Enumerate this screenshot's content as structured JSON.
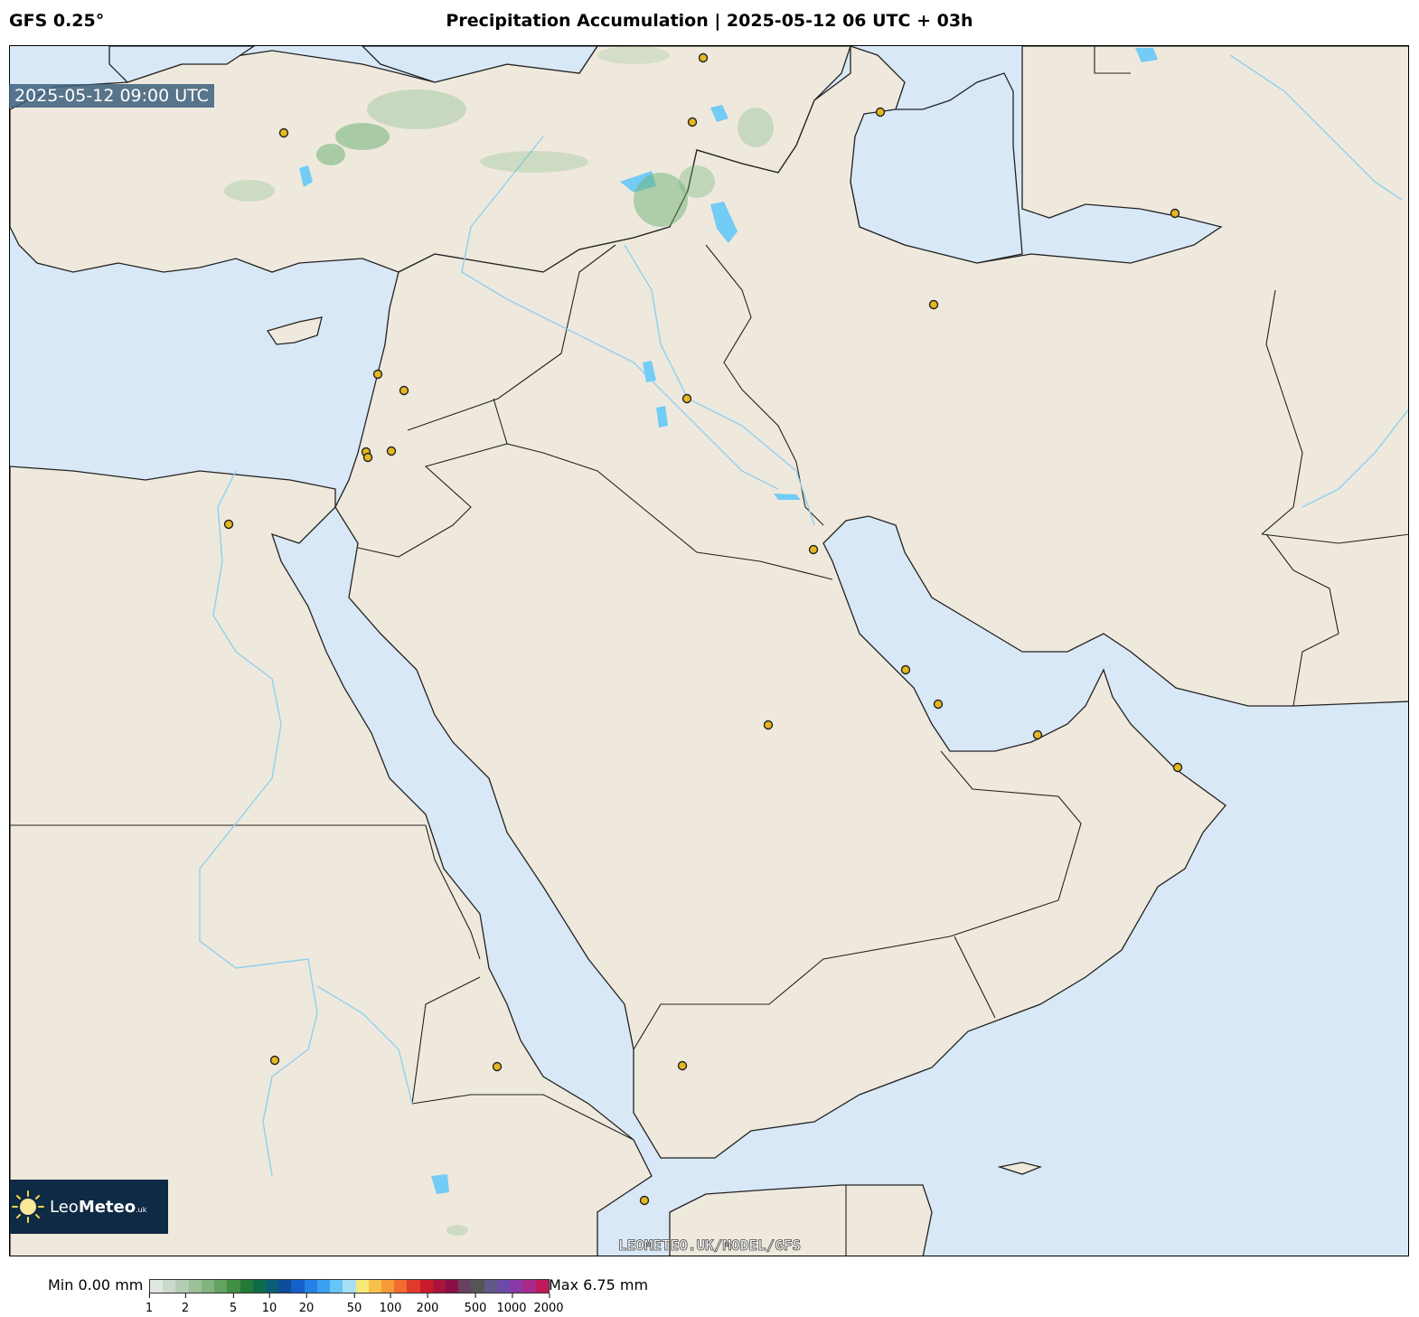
{
  "header": {
    "model": "GFS 0.25°",
    "title": "Precipitation Accumulation | 2025-05-12 06 UTC + 03h"
  },
  "map": {
    "valid_time": "2025-05-12 09:00 UTC",
    "watermark": "LEOMETEO.UK/MODEL/GFS",
    "colors": {
      "sea": "#d9e8f6",
      "land": "#efe9dd",
      "rivers": "#8fd0ef",
      "lakes": "#72ccf5",
      "city_marker": "#e6b820"
    }
  },
  "logo": {
    "name_light": "Leo",
    "name_bold": "Meteo",
    "suffix": ".uk",
    "icon": "sun-icon"
  },
  "legend": {
    "min_label": "Min 0.00 mm",
    "max_label": "Max 6.75 mm",
    "ticks": [
      "1",
      "2",
      "5",
      "10",
      "20",
      "50",
      "100",
      "200",
      "500",
      "1000",
      "2000"
    ],
    "colors": [
      "#dfe6df",
      "#cbd9cb",
      "#b5ccb4",
      "#9cc09a",
      "#82b37f",
      "#64a262",
      "#3f8f45",
      "#237a36",
      "#0e6b4a",
      "#0a5e74",
      "#0d4d9a",
      "#1560c8",
      "#2680e6",
      "#3aa0f0",
      "#66c4f7",
      "#a6e0f4",
      "#f6e77a",
      "#f7c24a",
      "#f59a38",
      "#f06c2f",
      "#e03a2a",
      "#c81c2c",
      "#a8143a",
      "#8a1048",
      "#6a4060",
      "#555",
      "#605a8a",
      "#6e4aa8",
      "#8a3aa8",
      "#a82a8a",
      "#c01a5a"
    ]
  }
}
